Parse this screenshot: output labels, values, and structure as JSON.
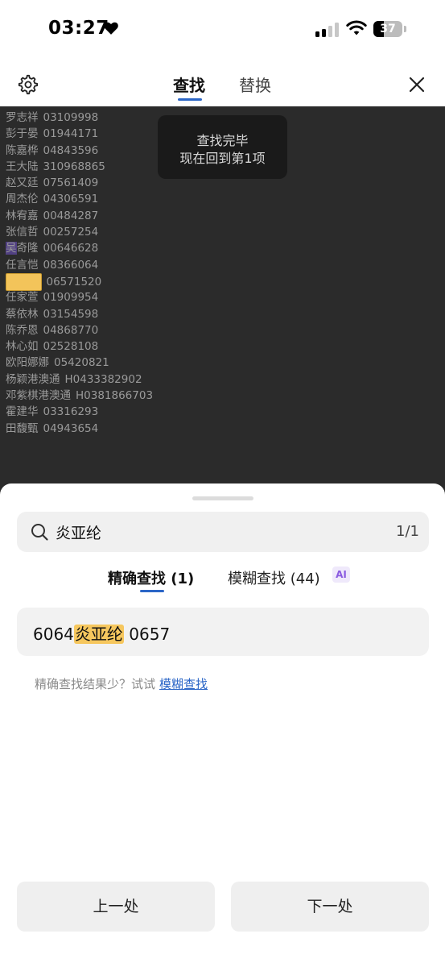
{
  "status_bar": {
    "time": "03:27",
    "battery": "37",
    "battery_level": 0.37
  },
  "toolbar": {
    "tabs": [
      {
        "label": "查找",
        "active": true
      },
      {
        "label": "替换",
        "active": false
      }
    ],
    "icons": [
      "gear-icon",
      "close-icon"
    ]
  },
  "document": {
    "rows": [
      {
        "name": "罗志祥",
        "code": "03109998"
      },
      {
        "name": "彭于晏",
        "code": "01944171"
      },
      {
        "name": "陈嘉桦",
        "code": "04843596"
      },
      {
        "name": "王大陆",
        "code": "310968865"
      },
      {
        "name": "赵又廷",
        "code": "07561409"
      },
      {
        "name": "周杰伦",
        "code": "04306591"
      },
      {
        "name": "林宥嘉",
        "code": "00484287"
      },
      {
        "name": "张信哲",
        "code": "00257254"
      },
      {
        "name": "吴奇隆",
        "code": "00646628"
      },
      {
        "name": "任言恺",
        "code": "08366064"
      },
      {
        "name": "炎亚纶",
        "code": "06571520"
      },
      {
        "name": "任家萱",
        "code": "01909954"
      },
      {
        "name": "蔡依林",
        "code": "03154598"
      },
      {
        "name": "陈乔恩",
        "code": "04868770"
      },
      {
        "name": "林心如",
        "code": "02528108"
      },
      {
        "name": "欧阳娜娜",
        "code": "05420821"
      },
      {
        "name": "杨颖港澳通",
        "code": "H0433382902"
      },
      {
        "name": "邓紫棋港澳通",
        "code": "H0381866703"
      },
      {
        "name": "霍建华",
        "code": "03316293"
      },
      {
        "name": "田馥甄",
        "code": "04943654"
      }
    ],
    "row9_first": "吴",
    "row9_rest": "奇隆",
    "toast": {
      "line1": "查找完毕",
      "line2": "现在回到第1项"
    }
  },
  "sheet": {
    "search": {
      "value": "炎亚纶",
      "count": "1/1"
    },
    "modes": [
      {
        "label": "精确查找 (1)",
        "active": true
      },
      {
        "label": "模糊查找 (44)",
        "active": false
      }
    ],
    "ai_badge": "AI",
    "result": {
      "before": "6064",
      "match": "炎亚纶",
      "after": " 0657"
    },
    "hint": {
      "text": "精确查找结果少？试试",
      "link": "模糊查找"
    },
    "prev_label": "上一处",
    "next_label": "下一处"
  },
  "colors": {
    "accent": "#2b66c7",
    "highlight": "#f6c75e",
    "dark_bg": "#2b2b2b",
    "ai_purple": "#8a5be0"
  }
}
